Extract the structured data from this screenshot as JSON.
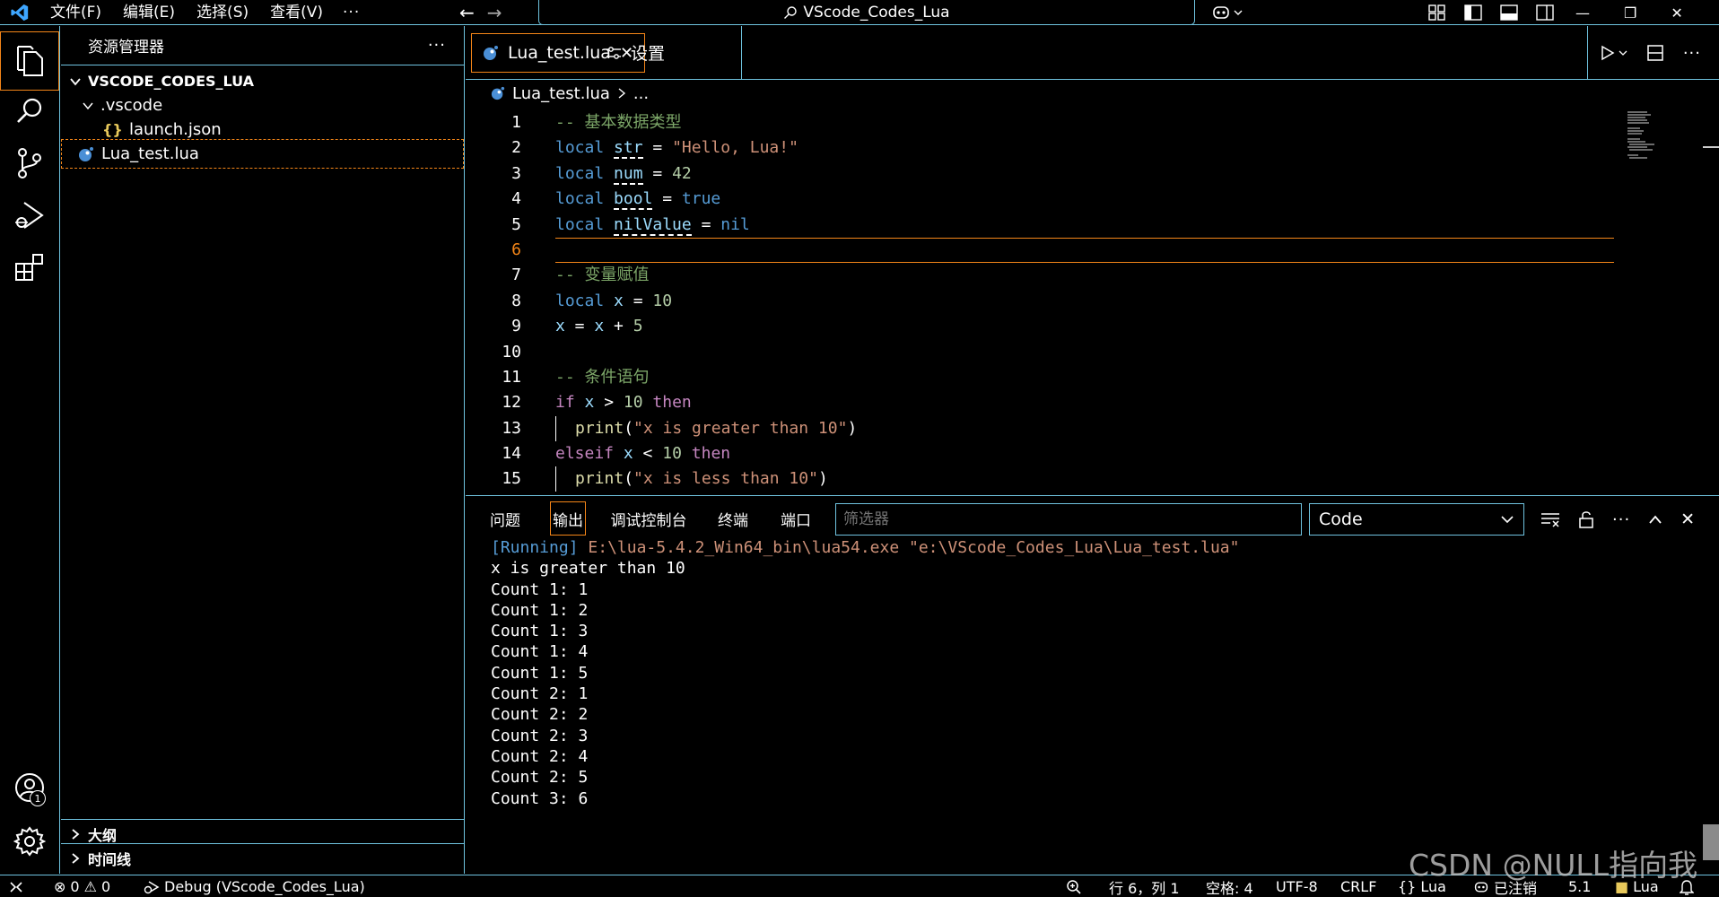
{
  "titlebar": {
    "menus": [
      "文件(F)",
      "编辑(E)",
      "选择(S)",
      "查看(V)"
    ],
    "more": "···",
    "search_title": "VScode_Codes_Lua"
  },
  "activity": {
    "account_badge": "1"
  },
  "sidebar": {
    "title": "资源管理器",
    "more": "···",
    "root": "VSCODE_CODES_LUA",
    "folder": ".vscode",
    "file_json": "launch.json",
    "file_lua": "Lua_test.lua",
    "outline": "大纲",
    "timeline": "时间线"
  },
  "editor": {
    "tabs": [
      {
        "label": "Lua_test.lua"
      },
      {
        "label": "设置"
      }
    ],
    "breadcrumb": {
      "file": "Lua_test.lua",
      "rest": "..."
    },
    "lines": [
      {
        "n": "1",
        "tokens": [
          {
            "t": "-- 基本数据类型",
            "c": "cmt"
          }
        ]
      },
      {
        "n": "2",
        "tokens": [
          {
            "t": "local",
            "c": "kw"
          },
          {
            "t": " "
          },
          {
            "t": "str",
            "c": "var uline"
          },
          {
            "t": " = "
          },
          {
            "t": "\"Hello, Lua!\"",
            "c": "str"
          }
        ]
      },
      {
        "n": "3",
        "tokens": [
          {
            "t": "local",
            "c": "kw"
          },
          {
            "t": " "
          },
          {
            "t": "num",
            "c": "var uline"
          },
          {
            "t": " = "
          },
          {
            "t": "42",
            "c": "num"
          }
        ]
      },
      {
        "n": "4",
        "tokens": [
          {
            "t": "local",
            "c": "kw"
          },
          {
            "t": " "
          },
          {
            "t": "bool",
            "c": "var uline"
          },
          {
            "t": " = "
          },
          {
            "t": "true",
            "c": "kw"
          }
        ]
      },
      {
        "n": "5",
        "tokens": [
          {
            "t": "local",
            "c": "kw"
          },
          {
            "t": " "
          },
          {
            "t": "nilValue",
            "c": "var uline"
          },
          {
            "t": " = "
          },
          {
            "t": "nil",
            "c": "kw"
          }
        ]
      },
      {
        "n": "6",
        "tokens": []
      },
      {
        "n": "7",
        "tokens": [
          {
            "t": "-- 变量赋值",
            "c": "cmt"
          }
        ]
      },
      {
        "n": "8",
        "tokens": [
          {
            "t": "local",
            "c": "kw"
          },
          {
            "t": " "
          },
          {
            "t": "x",
            "c": "var"
          },
          {
            "t": " = "
          },
          {
            "t": "10",
            "c": "num"
          }
        ]
      },
      {
        "n": "9",
        "tokens": [
          {
            "t": "x",
            "c": "var"
          },
          {
            "t": " = "
          },
          {
            "t": "x",
            "c": "var"
          },
          {
            "t": " + "
          },
          {
            "t": "5",
            "c": "num"
          }
        ]
      },
      {
        "n": "10",
        "tokens": []
      },
      {
        "n": "11",
        "tokens": [
          {
            "t": "-- 条件语句",
            "c": "cmt"
          }
        ]
      },
      {
        "n": "12",
        "tokens": [
          {
            "t": "if",
            "c": "ctl"
          },
          {
            "t": " "
          },
          {
            "t": "x",
            "c": "var"
          },
          {
            "t": " > "
          },
          {
            "t": "10",
            "c": "num"
          },
          {
            "t": " "
          },
          {
            "t": "then",
            "c": "ctl"
          }
        ]
      },
      {
        "n": "13",
        "tokens": [
          {
            "t": "",
            "c": "guide"
          },
          {
            "t": "print",
            "c": "fn"
          },
          {
            "t": "("
          },
          {
            "t": "\"x is greater than 10\"",
            "c": "str"
          },
          {
            "t": ")"
          }
        ]
      },
      {
        "n": "14",
        "tokens": [
          {
            "t": "elseif",
            "c": "ctl"
          },
          {
            "t": " "
          },
          {
            "t": "x",
            "c": "var"
          },
          {
            "t": " < "
          },
          {
            "t": "10",
            "c": "num"
          },
          {
            "t": " "
          },
          {
            "t": "then",
            "c": "ctl"
          }
        ]
      },
      {
        "n": "15",
        "tokens": [
          {
            "t": "",
            "c": "guide"
          },
          {
            "t": "print",
            "c": "fn"
          },
          {
            "t": "("
          },
          {
            "t": "\"x is less than 10\"",
            "c": "str"
          },
          {
            "t": ")"
          }
        ]
      }
    ],
    "current_line": "6"
  },
  "panel": {
    "tabs": [
      "问题",
      "输出",
      "调试控制台",
      "终端",
      "端口"
    ],
    "active_tab": "输出",
    "filter_placeholder": "筛选器",
    "channel": "Code",
    "output": {
      "running_tag": "[Running]",
      "running_cmd": "E:\\lua-5.4.2_Win64_bin\\lua54.exe \"e:\\VScode_Codes_Lua\\Lua_test.lua\"",
      "lines": [
        "x is greater than 10",
        "Count 1: 1",
        "Count 1: 2",
        "Count 1: 3",
        "Count 1: 4",
        "Count 1: 5",
        "Count 2: 1",
        "Count 2: 2",
        "Count 2: 3",
        "Count 2: 4",
        "Count 2: 5",
        "Count 3: 6"
      ]
    }
  },
  "statusbar": {
    "errors": "0",
    "warnings": "0",
    "debug": "Debug (VScode_Codes_Lua)",
    "position": "行 6，列 1",
    "spaces": "空格: 4",
    "encoding": "UTF-8",
    "eol": "CRLF",
    "language": "Lua",
    "registered": "已注销",
    "version": "5.1",
    "lua_ext": "Lua"
  },
  "watermark": "CSDN @NULL指向我",
  "colors": {
    "border": "#6fc3df",
    "focus": "#f38518",
    "keyword": "#569cd6",
    "string": "#ce9178",
    "comment": "#7ca668",
    "control": "#c586c0"
  }
}
